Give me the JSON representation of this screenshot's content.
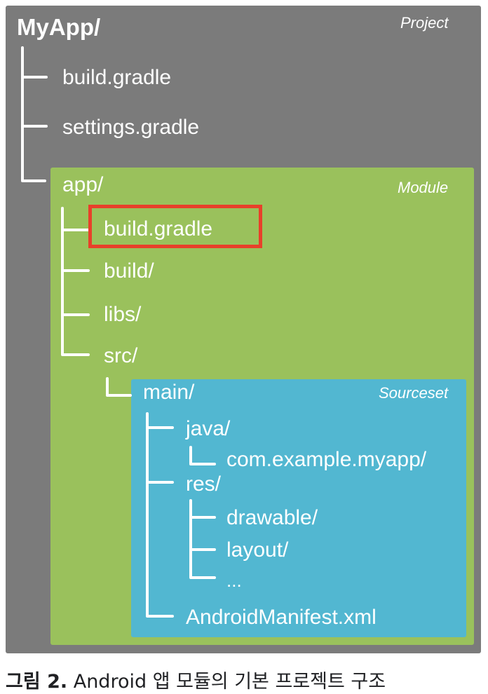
{
  "project": {
    "root": "MyApp/",
    "label": "Project",
    "files": [
      "build.gradle",
      "settings.gradle"
    ]
  },
  "module": {
    "root": "app/",
    "label": "Module",
    "items": [
      "build.gradle",
      "build/",
      "libs/",
      "src/"
    ],
    "highlighted_item": "build.gradle"
  },
  "sourceset": {
    "root": "main/",
    "label": "Sourceset",
    "java": "java/",
    "java_package": "com.example.myapp/",
    "res": "res/",
    "res_items": [
      "drawable/",
      "layout/",
      "..."
    ],
    "manifest": "AndroidManifest.xml"
  },
  "caption": {
    "label": "그림 2.",
    "text": "Android 앱 모듈의 기본 프로젝트 구조"
  },
  "colors": {
    "project_bg": "#7b7b7b",
    "module_bg": "#9ac15c",
    "sourceset_bg": "#52b7d1",
    "highlight": "#e8402a"
  }
}
